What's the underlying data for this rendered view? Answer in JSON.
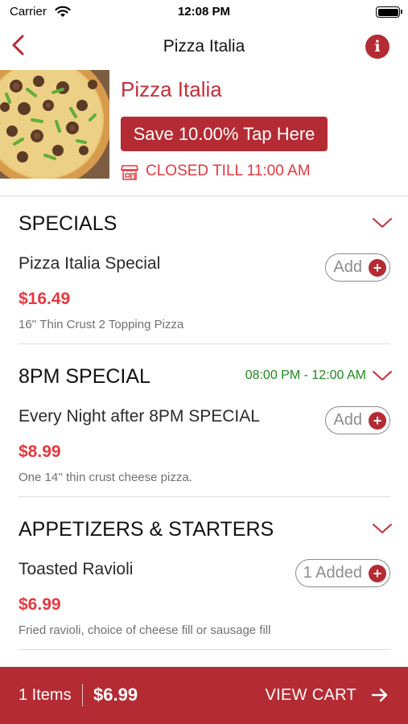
{
  "status_bar": {
    "carrier": "Carrier",
    "time": "12:08 PM"
  },
  "nav": {
    "title": "Pizza Italia",
    "back_icon": "chevron-left-icon",
    "info_icon": "info-icon"
  },
  "store": {
    "name": "Pizza Italia",
    "promo_label": "Save 10.00% Tap Here",
    "status": "CLOSED TILL 11:00 AM",
    "status_icon": "storefront-icon"
  },
  "sections": [
    {
      "title": "SPECIALS",
      "hours": "",
      "item": {
        "name": "Pizza Italia Special",
        "price": "$16.49",
        "description": "16'' Thin Crust 2 Topping Pizza",
        "button_label": "Add"
      }
    },
    {
      "title": "8PM SPECIAL",
      "hours": "08:00 PM - 12:00 AM",
      "item": {
        "name": "Every Night after 8PM SPECIAL",
        "price": "$8.99",
        "description": "One 14'' thin crust cheese pizza.",
        "button_label": "Add"
      }
    },
    {
      "title": "APPETIZERS & STARTERS",
      "hours": "",
      "item": {
        "name": "Toasted Ravioli",
        "price": "$6.99",
        "description": "Fried ravioli, choice of cheese fill or sausage fill",
        "button_label": "1 Added"
      }
    }
  ],
  "cart": {
    "count_label": "1 Items",
    "total": "$6.99",
    "view_label": "VIEW CART"
  },
  "colors": {
    "brand": "#b52b33",
    "price": "#e4393f",
    "hours": "#1d8a1d"
  }
}
